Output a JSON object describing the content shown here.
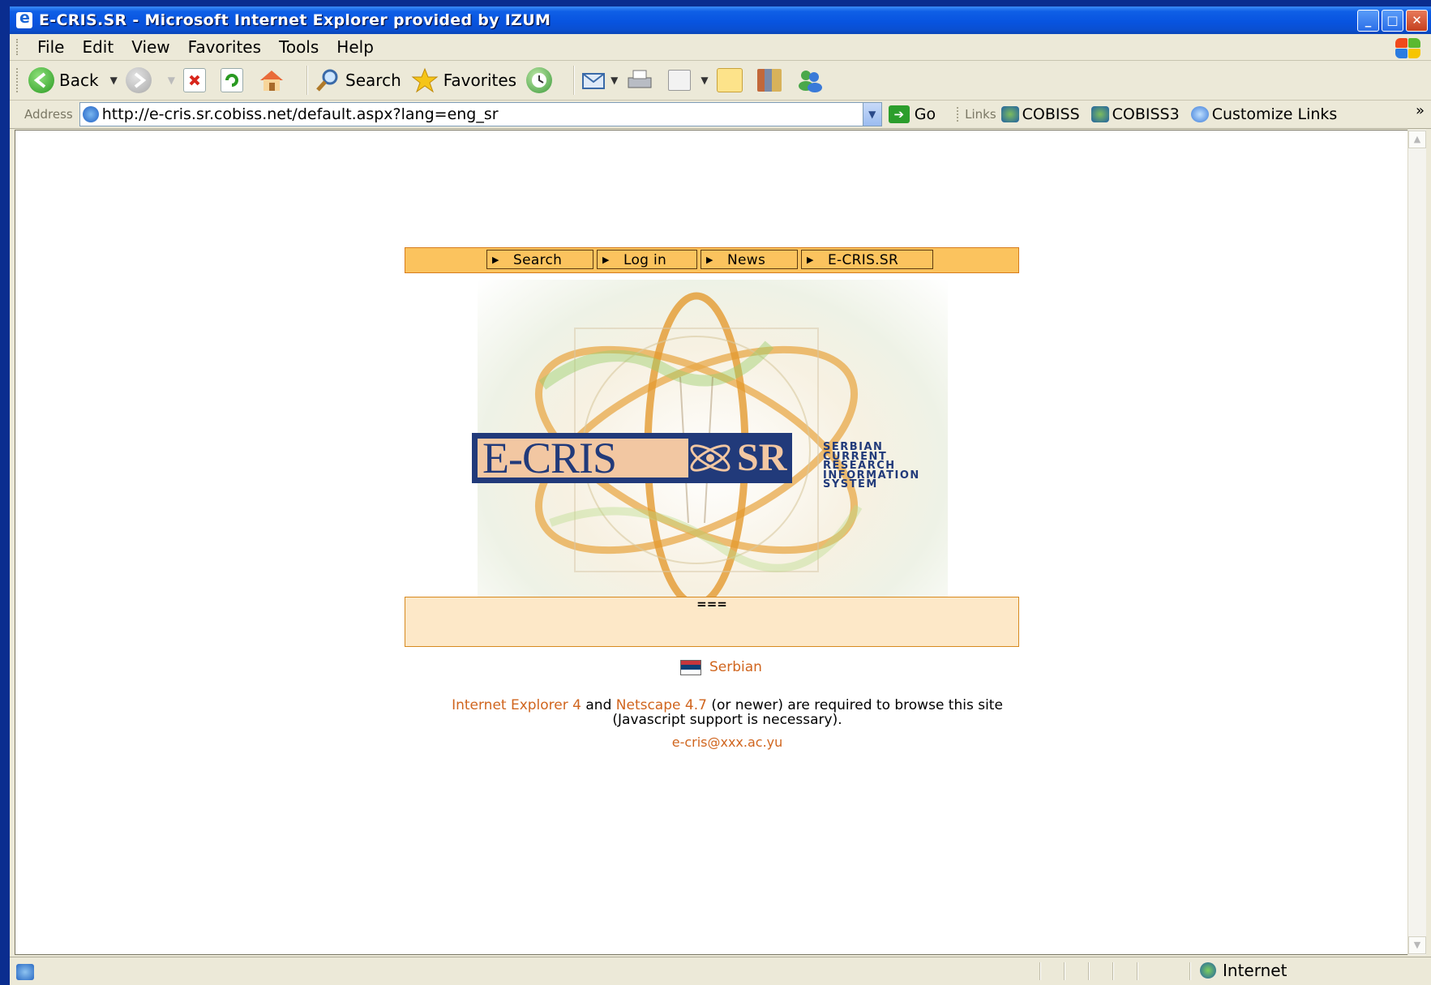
{
  "window": {
    "title": "E-CRIS.SR - Microsoft Internet Explorer provided by IZUM",
    "controls": [
      "minimize",
      "maximize",
      "close"
    ]
  },
  "menu": {
    "items": [
      "File",
      "Edit",
      "View",
      "Favorites",
      "Tools",
      "Help"
    ]
  },
  "toolbar": {
    "back_label": "Back",
    "search_label": "Search",
    "favorites_label": "Favorites"
  },
  "address": {
    "label": "Address",
    "url": "http://e-cris.sr.cobiss.net/default.aspx?lang=eng_sr",
    "go_label": "Go",
    "links_label": "Links",
    "links": [
      "COBISS",
      "COBISS3",
      "Customize Links"
    ],
    "overflow": "»"
  },
  "site": {
    "nav": [
      "Search",
      "Log in",
      "News",
      "E-CRIS.SR"
    ],
    "logo": {
      "main": "E-CRIS",
      "suffix": "SR",
      "tagline": [
        "SERBIAN",
        "CURRENT",
        "RESEARCH",
        "INFORMATION",
        "SYSTEM"
      ]
    },
    "message_separator": "===",
    "language_link": "Serbian",
    "requirements": {
      "browser1": "Internet Explorer 4",
      "and": "and",
      "browser2": "Netscape 4.7",
      "suffix": "(or newer) are required to browse this site",
      "line2": "(Javascript support is necessary)."
    },
    "email": "e-cris@xxx.ac.yu"
  },
  "status": {
    "zone": "Internet"
  },
  "colors": {
    "nav_bg": "#fbc35e",
    "link": "#d0651e",
    "logo_navy": "#213a7a",
    "logo_peach": "#f2c7a2"
  }
}
